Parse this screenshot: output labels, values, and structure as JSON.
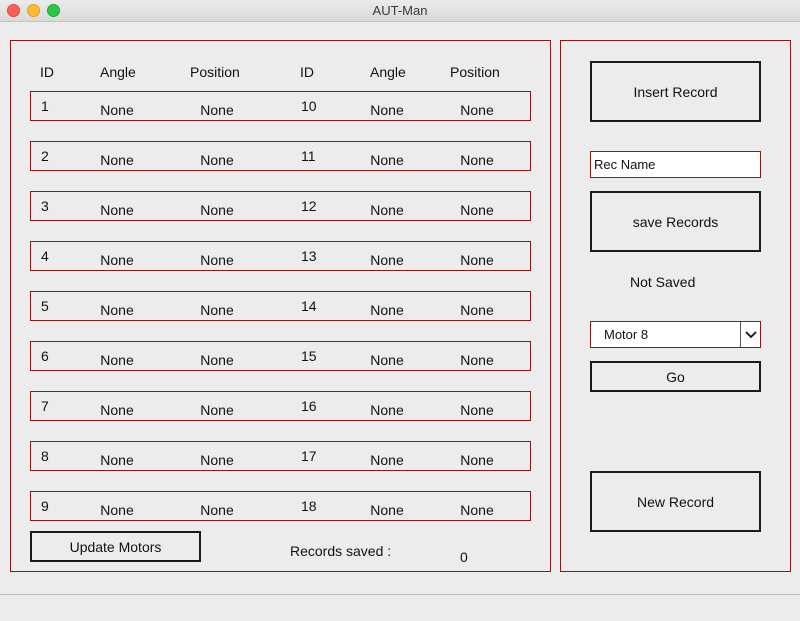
{
  "window": {
    "title": "AUT-Man"
  },
  "table": {
    "headers": [
      "ID",
      "Angle",
      "Position",
      "ID",
      "Angle",
      "Position"
    ],
    "rows": [
      {
        "id_left": "1",
        "angle_left": "None",
        "position_left": "None",
        "id_right": "10",
        "angle_right": "None",
        "position_right": "None"
      },
      {
        "id_left": "2",
        "angle_left": "None",
        "position_left": "None",
        "id_right": "11",
        "angle_right": "None",
        "position_right": "None"
      },
      {
        "id_left": "3",
        "angle_left": "None",
        "position_left": "None",
        "id_right": "12",
        "angle_right": "None",
        "position_right": "None"
      },
      {
        "id_left": "4",
        "angle_left": "None",
        "position_left": "None",
        "id_right": "13",
        "angle_right": "None",
        "position_right": "None"
      },
      {
        "id_left": "5",
        "angle_left": "None",
        "position_left": "None",
        "id_right": "14",
        "angle_right": "None",
        "position_right": "None"
      },
      {
        "id_left": "6",
        "angle_left": "None",
        "position_left": "None",
        "id_right": "15",
        "angle_right": "None",
        "position_right": "None"
      },
      {
        "id_left": "7",
        "angle_left": "None",
        "position_left": "None",
        "id_right": "16",
        "angle_right": "None",
        "position_right": "None"
      },
      {
        "id_left": "8",
        "angle_left": "None",
        "position_left": "None",
        "id_right": "17",
        "angle_right": "None",
        "position_right": "None"
      },
      {
        "id_left": "9",
        "angle_left": "None",
        "position_left": "None",
        "id_right": "18",
        "angle_right": "None",
        "position_right": "None"
      }
    ]
  },
  "footer": {
    "update_button": "Update Motors",
    "records_saved_label": "Records saved :",
    "records_saved_count": "0"
  },
  "sidebar": {
    "insert_button": "Insert Record",
    "rec_name_value": "Rec Name",
    "save_button": "save Records",
    "save_status": "Not Saved",
    "motor_select_value": "Motor 8",
    "go_button": "Go",
    "new_record_button": "New Record"
  },
  "icons": {
    "select_arrow": "chevron-down-icon"
  },
  "colors": {
    "border_accent": "#8a1a1a",
    "background": "#ececec"
  }
}
